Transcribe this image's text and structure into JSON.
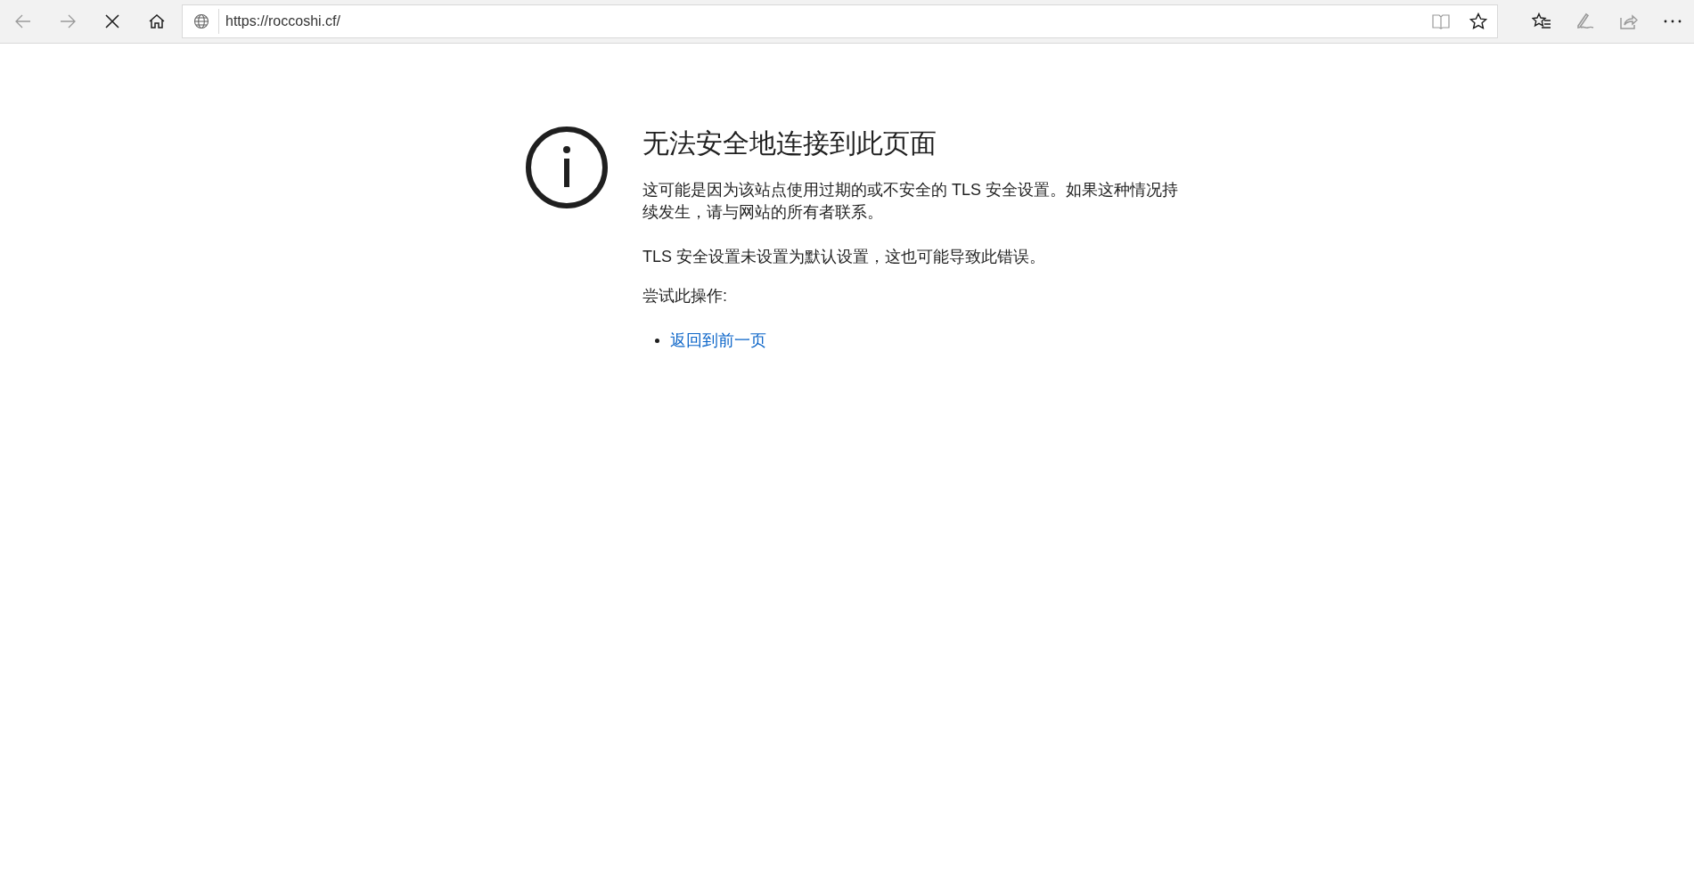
{
  "toolbar": {
    "nav_buttons": [
      {
        "kind": "back",
        "disabled": true
      },
      {
        "kind": "forward",
        "disabled": true
      },
      {
        "kind": "stop",
        "disabled": false
      },
      {
        "kind": "home",
        "disabled": false
      }
    ],
    "address_bar": {
      "url": "https://roccoshi.cf/",
      "buttons": [
        {
          "kind": "reading-view",
          "disabled": true
        },
        {
          "kind": "favorite",
          "disabled": false
        }
      ]
    },
    "tool_buttons": [
      {
        "kind": "favorites",
        "disabled": false
      },
      {
        "kind": "pen",
        "disabled": true
      },
      {
        "kind": "share",
        "disabled": true
      },
      {
        "kind": "more",
        "disabled": false
      }
    ]
  },
  "error_page": {
    "title": "无法安全地连接到此页面",
    "paragraphs": [
      "这可能是因为该站点使用过期的或不安全的 TLS 安全设置。如果这种情况持续发生，请与网站的所有者联系。",
      "TLS 安全设置未设置为默认设置，这也可能导致此错误。"
    ],
    "prompt": "尝试此操作:",
    "actions": [
      "返回到前一页"
    ]
  }
}
